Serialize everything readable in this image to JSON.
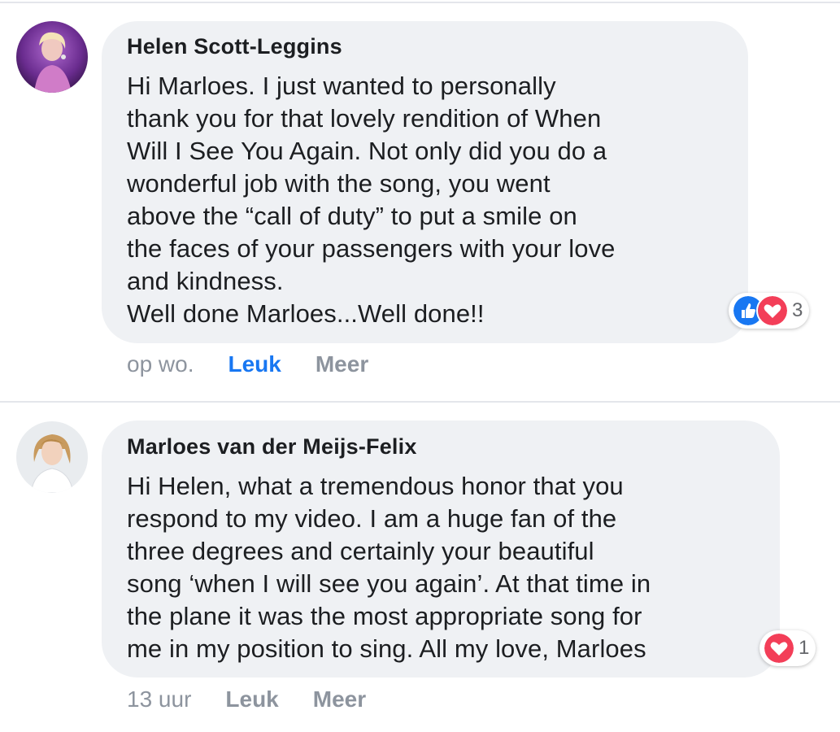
{
  "comments": [
    {
      "author": "Helen Scott-Leggins",
      "text": "Hi Marloes. I just wanted to personally\nthank you for that lovely rendition of When\nWill I See You Again. Not only did you do a\nwonderful job with the song, you went\nabove the “call of duty” to put a smile on\nthe faces of your passengers with your love\nand kindness.\nWell done Marloes...Well done!!",
      "reactions": {
        "types": [
          "like",
          "love"
        ],
        "count": "3"
      },
      "timestamp": "op wo.",
      "like_label": "Leuk",
      "like_active": true,
      "more_label": "Meer"
    },
    {
      "author": "Marloes van der Meijs-Felix",
      "text": "Hi Helen, what a tremendous honor that you\nrespond to my video. I am a huge fan of the\nthree degrees and certainly your beautiful\nsong ‘when I will see you again’. At that time in\nthe plane it was the most appropriate song for\nme in my position to sing. All my love, Marloes",
      "reactions": {
        "types": [
          "love"
        ],
        "count": "1"
      },
      "timestamp": "13 uur",
      "like_label": "Leuk",
      "like_active": false,
      "more_label": "Meer"
    }
  ],
  "colors": {
    "like_active": "#1877f2",
    "muted": "#8d949e",
    "bubble": "#eff1f4",
    "love": "#f33e58"
  }
}
